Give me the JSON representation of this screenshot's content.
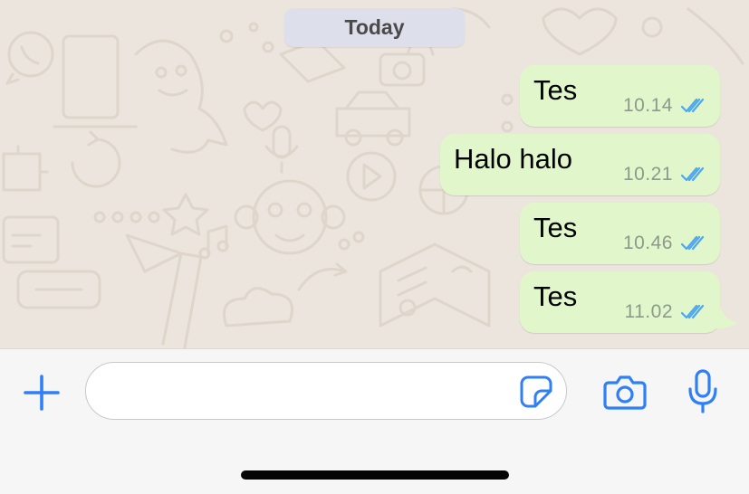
{
  "chat": {
    "date_separator": "Today",
    "messages": [
      {
        "text": "Tes",
        "time": "10.14",
        "status": "read-double-tick-icon"
      },
      {
        "text": "Halo halo",
        "time": "10.21",
        "status": "read-double-tick-icon"
      },
      {
        "text": "Tes",
        "time": "10.46",
        "status": "read-double-tick-icon"
      },
      {
        "text": "Tes",
        "time": "11.02",
        "status": "read-double-tick-icon"
      }
    ]
  },
  "composer": {
    "value": "",
    "placeholder": "",
    "icons": [
      "plus-icon",
      "sticker-icon",
      "camera-icon",
      "microphone-icon"
    ]
  },
  "colors": {
    "accent": "#2f7ff6",
    "bubble_outgoing": "#e1f7cb",
    "chat_background": "#ece5dd",
    "read_tick": "#4fa7f0",
    "date_pill": "#dddfea"
  }
}
